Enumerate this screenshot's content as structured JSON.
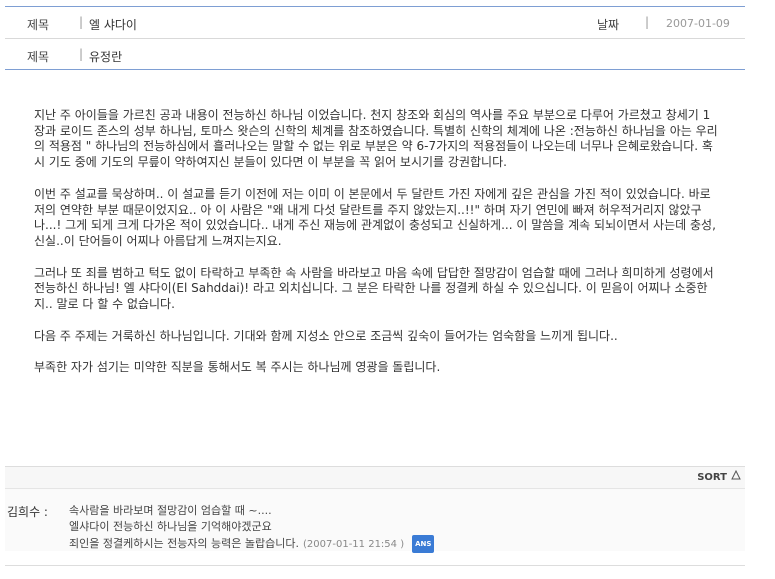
{
  "post": {
    "subject_label": "제목",
    "subject_sep": "|",
    "subject": "엘 샤다이",
    "date_label": "날짜",
    "date_sep": "|",
    "date": "2007-01-09",
    "author_label": "제목",
    "author_sep": "|",
    "author": "유정란"
  },
  "body": {
    "paragraphs": [
      "지난 주 아이들을 가르친 공과 내용이 전능하신 하나님 이었습니다. 천지 창조와 회심의 역사를 주요 부분으로 다루어 가르쳤고 창세기 1장과 로이드 존스의 성부 하나님, 토마스 왓슨의 신학의 체계를 참조하였습니다. 특별히 신학의 체계에 나온 :전능하신 하나님을 아는 우리의 적용점 \" 하나님의 전능하심에서 흘러나오는 말할 수 없는 위로 부분은 약 6-7가지의 적용점들이 나오는데 너무나 은혜로왔습니다. 혹시 기도 중에 기도의 무릎이 약하여지신 분들이 있다면 이 부분을 꼭 읽어 보시기를 강권합니다.",
      "이번 주 설교를 묵상하며.. 이 설교를 듣기 이전에 저는 이미 이 본문에서 두 달란트 가진 자에게 깊은 관심을 가진 적이 있었습니다. 바로 저의 연약한 부분 때문이었지요.. 아 이 사람은 \"왜 내게 다섯 달란트를 주지 않았는지..!!\" 하며 자기 연민에 빠져 허우적거리지 않았구나...! 그게 되게 크게 다가온 적이 있었습니다.. 내게 주신 재능에 관계없이 충성되고 신실하게... 이 말씀을 계속 되뇌이면서 사는데 충성, 신실..이 단어들이 어찌나 아름답게 느껴지는지요.",
      "그러나 또 죄를 범하고 턱도 없이 타락하고 부족한 속 사람을 바라보고 마음 속에 답답한 절망감이 엄습할 때에 그러나 희미하게 성령에서 전능하신 하나님! 엘 샤다이(El Sahddai)! 라고 외치십니다. 그 분은 타락한 나를 정결케 하실 수 있으십니다. 이 믿음이 어찌나 소중한지.. 말로 다 할 수 없습니다.",
      "다음 주 주제는 거룩하신 하나님입니다. 기대와 함께 지성소 안으로 조금씩 깊숙이 들어가는 엄숙함을 느끼게 됩니다..",
      "부족한 자가 섬기는 미약한 직분을 통해서도 복 주시는 하나님께 영광을 돌립니다."
    ]
  },
  "sort": {
    "label": "SORT",
    "icon": "triangle-up-icon"
  },
  "comments": [
    {
      "author": "김희수 :",
      "lines": [
        "속사람을 바라보며 절망감이 엄습할 때 ~....",
        "엘샤다이 전능하신 하나님을 기억해야겠군요",
        "죄인을 정결케하시는 전능자의 능력은 놀랍습니다."
      ],
      "date": "(2007-01-11 21:54 )",
      "badge": "ANS"
    }
  ],
  "colors": {
    "blue_line": "#7e9ed3",
    "badge": "#3a7bd5"
  }
}
